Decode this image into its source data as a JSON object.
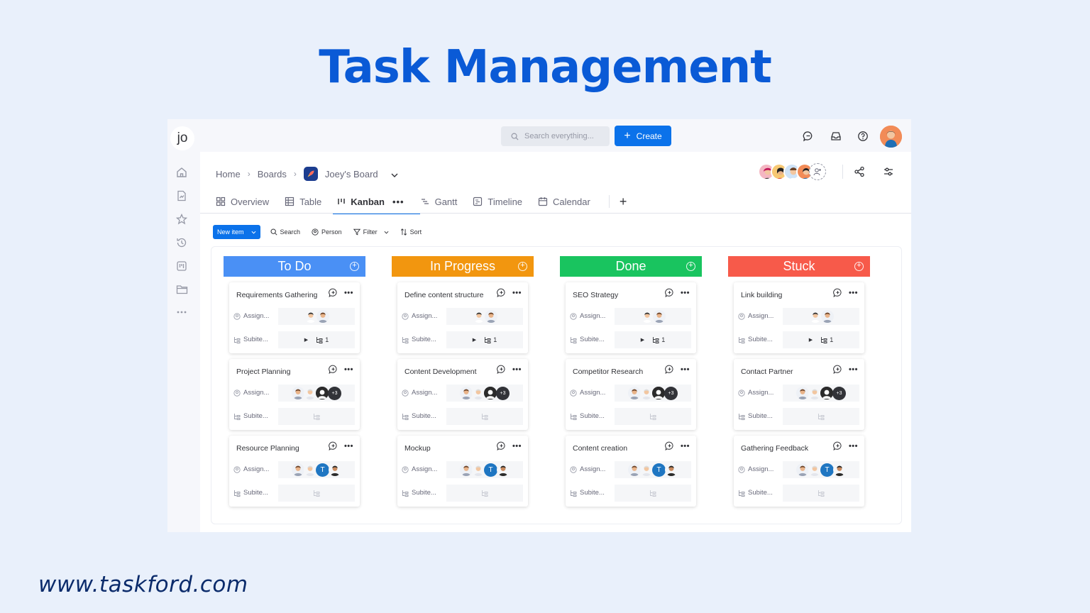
{
  "hero": {
    "title": "Task Management",
    "website": "www.taskford.com"
  },
  "rail": {
    "logo": "jo",
    "icons": [
      "home-icon",
      "report-icon",
      "star-icon",
      "history-icon",
      "kanban-icon",
      "folder-icon",
      "more-icon"
    ]
  },
  "topbar": {
    "search_placeholder": "Search everything...",
    "create_label": "Create",
    "icons": [
      "chat-icon",
      "inbox-icon",
      "help-icon"
    ]
  },
  "breadcrumb": {
    "home": "Home",
    "boards": "Boards",
    "board": "Joey's Board"
  },
  "tabs": [
    {
      "label": "Overview",
      "icon": "overview-icon"
    },
    {
      "label": "Table",
      "icon": "table-icon"
    },
    {
      "label": "Kanban",
      "icon": "kanban-icon",
      "active": true
    },
    {
      "label": "Gantt",
      "icon": "gantt-icon"
    },
    {
      "label": "Timeline",
      "icon": "timeline-icon"
    },
    {
      "label": "Calendar",
      "icon": "calendar-icon"
    }
  ],
  "toolbar": {
    "new_item": "New item",
    "search": "Search",
    "person": "Person",
    "filter": "Filter",
    "sort": "Sort"
  },
  "field_labels": {
    "assignee": "Assign...",
    "subitems": "Subite..."
  },
  "colors": {
    "todo": "#4a90f5",
    "in_progress": "#f2960f",
    "done": "#19c45f",
    "stuck": "#f75a4a",
    "accent": "#0b72ea",
    "title": "#0a5ad6"
  },
  "columns": [
    {
      "title": "To Do",
      "cards": [
        {
          "title": "Requirements Gathering",
          "subitems": "1"
        },
        {
          "title": "Project Planning",
          "extra": "+3"
        },
        {
          "title": "Resource Planning",
          "initial": "T"
        }
      ]
    },
    {
      "title": "In Progress",
      "cards": [
        {
          "title": "Define content structure",
          "subitems": "1"
        },
        {
          "title": "Content Development",
          "extra": "+3"
        },
        {
          "title": "Mockup",
          "initial": "T"
        }
      ]
    },
    {
      "title": "Done",
      "cards": [
        {
          "title": "SEO Strategy",
          "subitems": "1"
        },
        {
          "title": "Competitor Research",
          "extra": "+3"
        },
        {
          "title": "Content creation",
          "initial": "T"
        }
      ]
    },
    {
      "title": "Stuck",
      "cards": [
        {
          "title": "Link building",
          "subitems": "1"
        },
        {
          "title": "Contact Partner",
          "extra": "+3"
        },
        {
          "title": "Gathering Feedback",
          "initial": "T"
        }
      ]
    }
  ]
}
